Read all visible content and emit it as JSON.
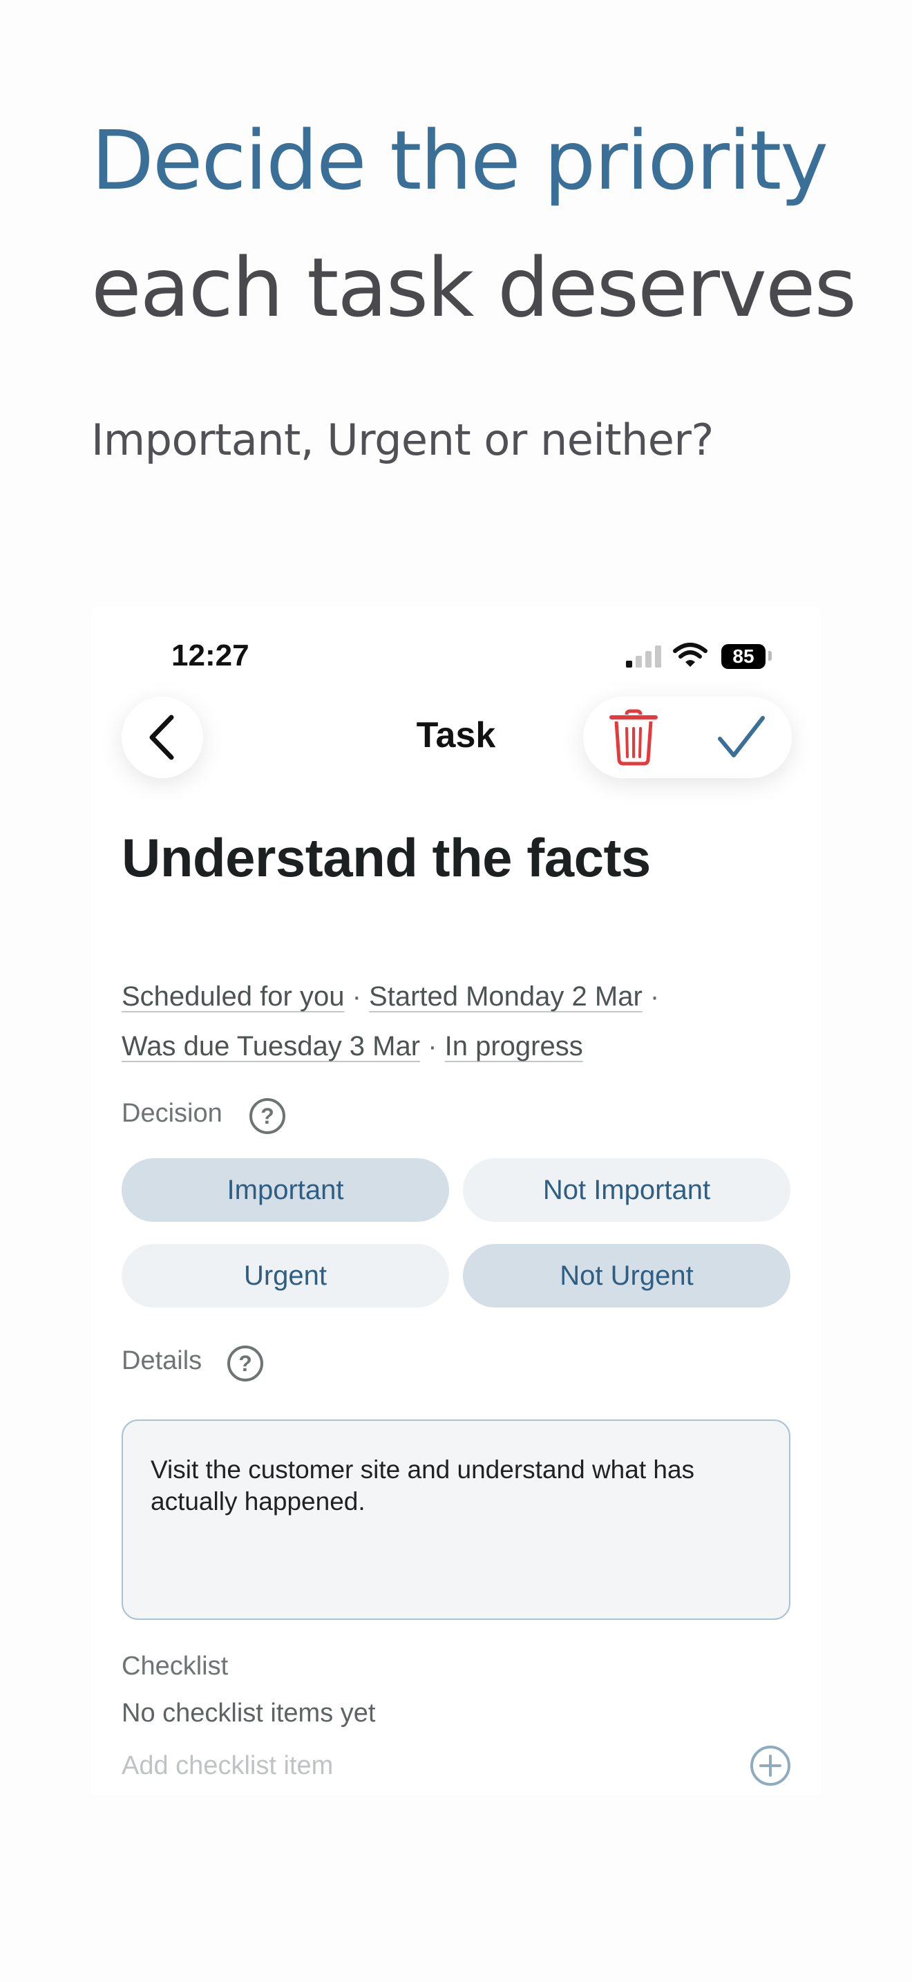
{
  "hero": {
    "title_line_1": "Decide the priority",
    "title_line_2": "each task deserves",
    "subtitle": "Important, Urgent or neither?"
  },
  "status_bar": {
    "time": "12:27",
    "battery": "85"
  },
  "nav": {
    "title": "Task",
    "back_icon": "chevron-left-icon",
    "delete_icon": "trash-icon",
    "save_icon": "checkmark-icon"
  },
  "task": {
    "title": "Understand the facts",
    "meta": {
      "scheduled": "Scheduled for you",
      "started": "Started Monday 2 Mar",
      "due": "Was due Tuesday 3 Mar",
      "status": "In progress",
      "separator": "·"
    },
    "decision": {
      "label": "Decision",
      "options": [
        {
          "label": "Important",
          "selected": true
        },
        {
          "label": "Not Important",
          "selected": false
        },
        {
          "label": "Urgent",
          "selected": false
        },
        {
          "label": "Not Urgent",
          "selected": true
        }
      ]
    },
    "details": {
      "label": "Details",
      "text": "Visit the customer site and understand what has actually happened."
    },
    "checklist": {
      "label": "Checklist",
      "empty_text": "No checklist items yet",
      "add_placeholder": "Add checklist item"
    }
  },
  "colors": {
    "accent": "#3a6f98",
    "toggle_selected": "#d4dee7",
    "toggle_unselected": "#eef2f5",
    "delete": "#e5393c"
  }
}
